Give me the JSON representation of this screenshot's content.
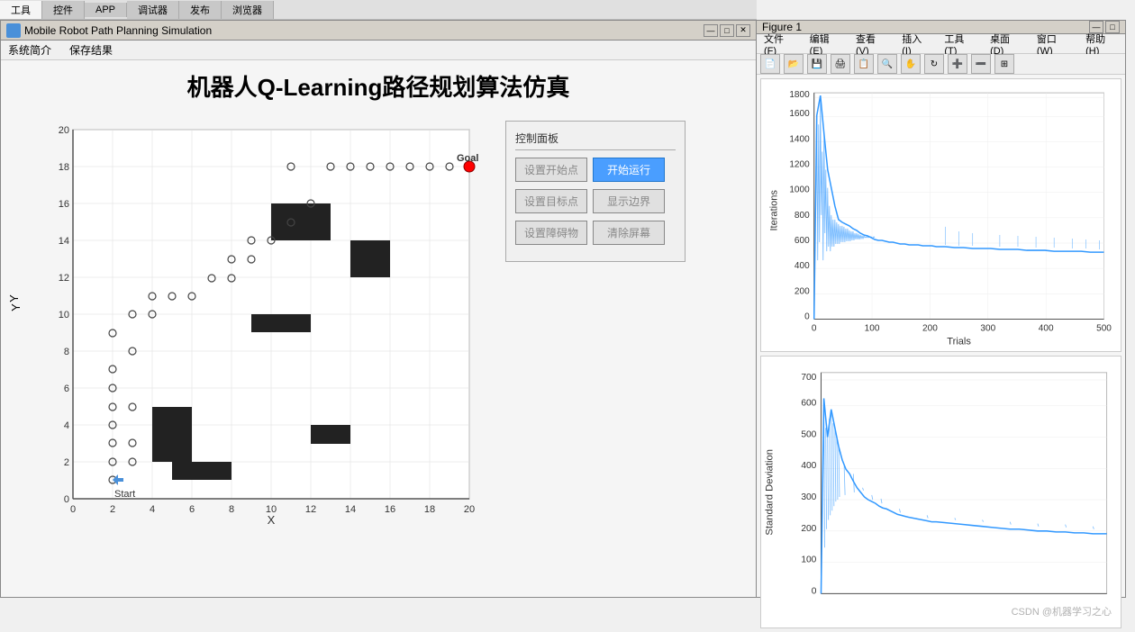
{
  "top_tabs": {
    "tabs": [
      "工具",
      "控件",
      "APP",
      "调试器",
      "发布",
      "浏览器"
    ],
    "active_index": 0
  },
  "main_window": {
    "title": "Mobile Robot Path Planning Simulation",
    "menu": [
      "系统简介",
      "保存结果"
    ],
    "page_title": "机器人Q-Learning路径规划算法仿真",
    "minimize_btn": "—",
    "restore_btn": "□",
    "close_btn": "✕"
  },
  "control_panel": {
    "title": "控制面板",
    "buttons": [
      {
        "label": "设置开始点",
        "id": "set-start",
        "active": false
      },
      {
        "label": "开始运行",
        "id": "start-run",
        "active": true
      },
      {
        "label": "设置目标点",
        "id": "set-goal",
        "active": false
      },
      {
        "label": "显示边界",
        "id": "show-border",
        "active": false
      },
      {
        "label": "设置障碍物",
        "id": "set-obstacle",
        "active": false
      },
      {
        "label": "清除屏幕",
        "id": "clear-screen",
        "active": false
      }
    ]
  },
  "plot": {
    "x_label": "X",
    "y_label": "Y",
    "x_min": 0,
    "x_max": 20,
    "y_min": 0,
    "y_max": 20,
    "x_ticks": [
      0,
      2,
      4,
      6,
      8,
      10,
      12,
      14,
      16,
      18,
      20
    ],
    "y_ticks": [
      0,
      2,
      4,
      6,
      8,
      10,
      12,
      14,
      16,
      18,
      20
    ],
    "goal_label": "Goal",
    "start_label": "Start"
  },
  "charts_window": {
    "title": "Figure 1",
    "menu_items": [
      "文件(F)",
      "编辑(E)",
      "查看(V)",
      "插入(I)",
      "工具(T)",
      "桌面(D)",
      "窗口(W)",
      "帮助(H)"
    ],
    "chart1": {
      "title": "",
      "x_label": "Trials",
      "y_label": "Iterations",
      "x_max": 500,
      "y_max": 1800,
      "x_ticks": [
        0,
        100,
        200,
        300,
        400,
        500
      ],
      "y_ticks": [
        0,
        200,
        400,
        600,
        800,
        1000,
        1200,
        1400,
        1600,
        1800
      ]
    },
    "chart2": {
      "title": "",
      "x_label": "",
      "y_label": "Standard Deviation",
      "x_max": 500,
      "y_max": 700,
      "y_ticks": [
        0,
        100,
        200,
        300,
        400,
        500,
        600,
        700
      ]
    }
  },
  "watermark": "CSDN @机器学习之心"
}
